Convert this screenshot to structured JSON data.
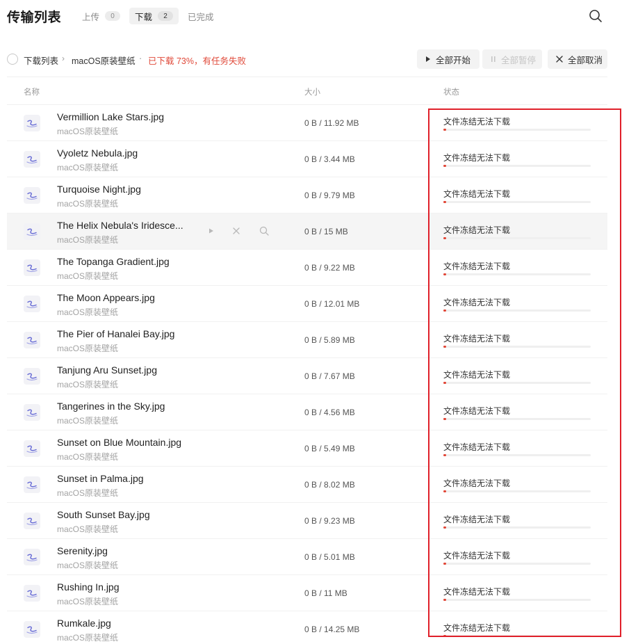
{
  "header": {
    "title": "传输列表",
    "tabs": [
      {
        "label": "上传",
        "count": "0",
        "active": false
      },
      {
        "label": "下载",
        "count": "2",
        "active": true
      },
      {
        "label": "已完成",
        "count": null,
        "active": false
      }
    ],
    "search_icon": "search-icon"
  },
  "toolbar": {
    "crumb_root": "下载列表",
    "crumb_sep": "›",
    "crumb_folder": "macOS原装壁纸",
    "crumb_dot": "·",
    "status": "已下载 73%，有任务失败",
    "buttons": {
      "start_all": "全部开始",
      "pause_all": "全部暂停",
      "cancel_all": "全部取消"
    }
  },
  "columns": {
    "name": "名称",
    "size": "大小",
    "status": "状态"
  },
  "colors": {
    "accent_red": "#e24536",
    "icon_purple": "#6b6fd6"
  },
  "rows": [
    {
      "name": "Vermillion Lake Stars.jpg",
      "folder": "macOS原装壁纸",
      "size": "0 B / 11.92 MB",
      "status": "文件冻结无法下载",
      "progress": 0.02
    },
    {
      "name": "Vyoletz Nebula.jpg",
      "folder": "macOS原装壁纸",
      "size": "0 B / 3.44 MB",
      "status": "文件冻结无法下载",
      "progress": 0.02
    },
    {
      "name": "Turquoise Night.jpg",
      "folder": "macOS原装壁纸",
      "size": "0 B / 9.79 MB",
      "status": "文件冻结无法下载",
      "progress": 0.02
    },
    {
      "name": "The Helix Nebula's Iridesce...",
      "folder": "macOS原装壁纸",
      "size": "0 B / 15 MB",
      "status": "文件冻结无法下载",
      "progress": 0.02,
      "hover": true
    },
    {
      "name": "The Topanga Gradient.jpg",
      "folder": "macOS原装壁纸",
      "size": "0 B / 9.22 MB",
      "status": "文件冻结无法下载",
      "progress": 0.02
    },
    {
      "name": "The Moon Appears.jpg",
      "folder": "macOS原装壁纸",
      "size": "0 B / 12.01 MB",
      "status": "文件冻结无法下载",
      "progress": 0.02
    },
    {
      "name": "The Pier of Hanalei Bay.jpg",
      "folder": "macOS原装壁纸",
      "size": "0 B / 5.89 MB",
      "status": "文件冻结无法下载",
      "progress": 0.02
    },
    {
      "name": "Tanjung Aru Sunset.jpg",
      "folder": "macOS原装壁纸",
      "size": "0 B / 7.67 MB",
      "status": "文件冻结无法下载",
      "progress": 0.02
    },
    {
      "name": "Tangerines in the Sky.jpg",
      "folder": "macOS原装壁纸",
      "size": "0 B / 4.56 MB",
      "status": "文件冻结无法下载",
      "progress": 0.02
    },
    {
      "name": "Sunset on Blue Mountain.jpg",
      "folder": "macOS原装壁纸",
      "size": "0 B / 5.49 MB",
      "status": "文件冻结无法下载",
      "progress": 0.02
    },
    {
      "name": "Sunset in Palma.jpg",
      "folder": "macOS原装壁纸",
      "size": "0 B / 8.02 MB",
      "status": "文件冻结无法下载",
      "progress": 0.02
    },
    {
      "name": "South Sunset Bay.jpg",
      "folder": "macOS原装壁纸",
      "size": "0 B / 9.23 MB",
      "status": "文件冻结无法下载",
      "progress": 0.02
    },
    {
      "name": "Serenity.jpg",
      "folder": "macOS原装壁纸",
      "size": "0 B / 5.01 MB",
      "status": "文件冻结无法下载",
      "progress": 0.02
    },
    {
      "name": "Rushing In.jpg",
      "folder": "macOS原装壁纸",
      "size": "0 B / 11 MB",
      "status": "文件冻结无法下载",
      "progress": 0.02
    },
    {
      "name": "Rumkale.jpg",
      "folder": "macOS原装壁纸",
      "size": "0 B / 14.25 MB",
      "status": "文件冻结无法下载",
      "progress": 0.02
    }
  ]
}
